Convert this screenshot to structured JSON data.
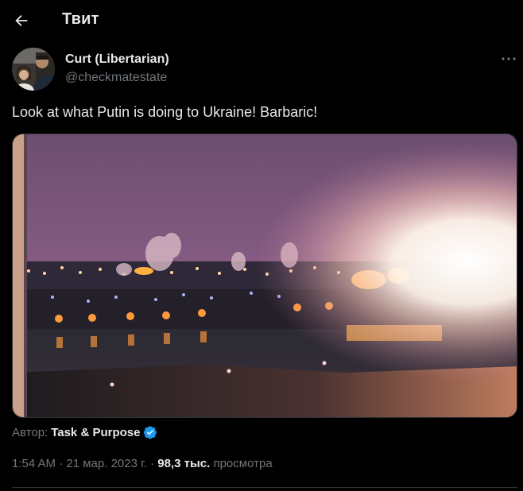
{
  "header": {
    "title": "Твит",
    "back_icon": "arrow-left-icon"
  },
  "author": {
    "name": "Curt (Libertarian)",
    "handle": "@checkmatestate",
    "more_icon": "more-horizontal-icon"
  },
  "tweet": {
    "text": "Look at what Putin is doing to Ukraine! Barbaric!"
  },
  "media": {
    "type": "image",
    "icon": "night-explosion-photo"
  },
  "source": {
    "label": "Автор:",
    "name": "Task & Purpose",
    "verified_icon": "verified-badge-icon",
    "verified_color": "#1d9bf0"
  },
  "meta": {
    "time": "1:54 AM",
    "sep1": "·",
    "date": "21 мар. 2023 г.",
    "sep2": "·",
    "views": "98,3 тыс.",
    "views_label": "просмотра"
  },
  "colors": {
    "background": "#000000",
    "text_primary": "#e7e9ea",
    "text_secondary": "#71767b",
    "border": "#2f3336"
  }
}
